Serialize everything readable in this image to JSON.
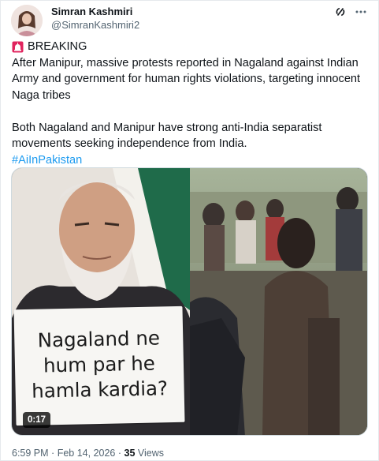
{
  "author": {
    "display_name": "Simran Kashmiri",
    "handle": "@SimranKashmiri2",
    "avatar_icon": "profile-avatar"
  },
  "header_icons": {
    "grok_icon": "grok-icon",
    "more_icon": "more-options-icon"
  },
  "tweet": {
    "breaking_label": "BREAKING",
    "paragraph_1": "After Manipur, massive protests reported in Nagaland against Indian Army and government for human rights violations, targeting innocent Naga tribes",
    "paragraph_2": "Both Nagaland and Manipur have strong anti-India separatist movements seeking independence from India.",
    "hashtag": "#AiInPakistan"
  },
  "media": {
    "sign_line_1": "Nagaland ne",
    "sign_line_2": "hum par he",
    "sign_line_3": "hamla kardia?",
    "duration": "0:17"
  },
  "meta": {
    "time": "6:59 PM",
    "separator": "·",
    "date": "Feb 14, 2026",
    "views_count": "35",
    "views_label": "Views"
  },
  "colors": {
    "accent": "#1d9bf0",
    "text_primary": "#0f1419",
    "text_secondary": "#536471"
  }
}
